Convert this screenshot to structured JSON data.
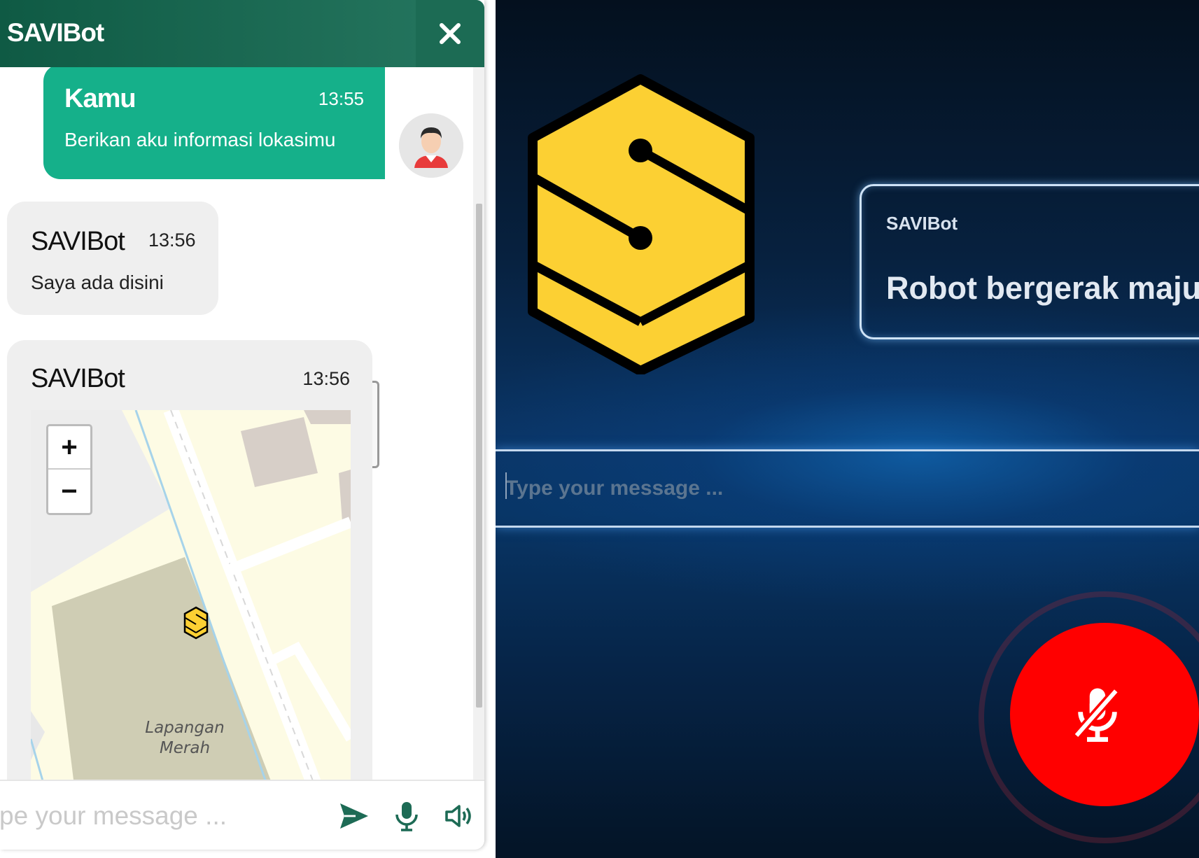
{
  "chat": {
    "title": "SAVIBot",
    "close_icon": "close-icon",
    "messages": [
      {
        "sender": "Kamu",
        "time": "13:55",
        "text": "Berikan aku informasi lokasimu"
      },
      {
        "sender": "SAVIBot",
        "time": "13:56",
        "text": "Saya ada disini"
      },
      {
        "sender": "SAVIBot",
        "time": "13:56",
        "map": {
          "zoom_in": "+",
          "zoom_out": "−",
          "place_label_1": "Lapangan",
          "place_label_2": "Merah"
        }
      }
    ],
    "input": {
      "placeholder": "Type your message ...",
      "value": ""
    },
    "icons": [
      "send-icon",
      "microphone-icon",
      "speaker-icon"
    ]
  },
  "stage": {
    "speech_card": {
      "name": "SAVIBot",
      "text": "Robot bergerak maju"
    },
    "input": {
      "placeholder": "Type your message ...",
      "value": ""
    },
    "mic_button": {
      "icon": "microphone-muted-icon",
      "color": "#ff0000"
    }
  },
  "colors": {
    "header": "#0f5a44",
    "user_bubble": "#15b08a",
    "logo_yellow": "#fcd033",
    "mic_red": "#ff0000"
  }
}
